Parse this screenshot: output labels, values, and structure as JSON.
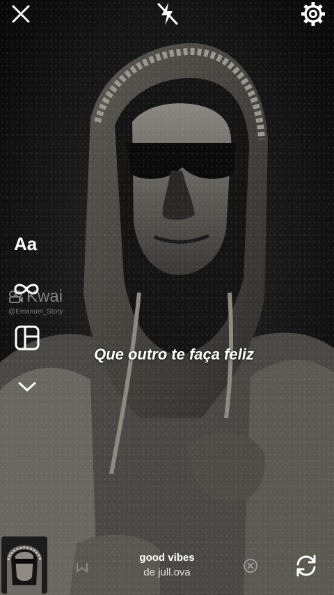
{
  "top_bar": {
    "close_icon": "close-icon",
    "flash_icon": "flash-off-icon",
    "settings_icon": "gear-icon"
  },
  "side_tools": {
    "text_label": "Aa",
    "boomerang_icon": "infinity-icon",
    "layout_icon": "layout-grid-icon",
    "more_icon": "chevron-down-icon"
  },
  "watermark": {
    "brand": "Kwai",
    "handle": "@Emanuel_Story"
  },
  "caption": "Que outro te faça feliz",
  "music": {
    "title": "good vibes",
    "artist": "de jull.ova"
  },
  "bottom_icons": {
    "bookmark": "bookmark-icon",
    "remove": "remove-circle-icon",
    "flip": "flip-camera-icon"
  },
  "colors": {
    "background": "#0f0f0f",
    "text": "#ffffff"
  }
}
